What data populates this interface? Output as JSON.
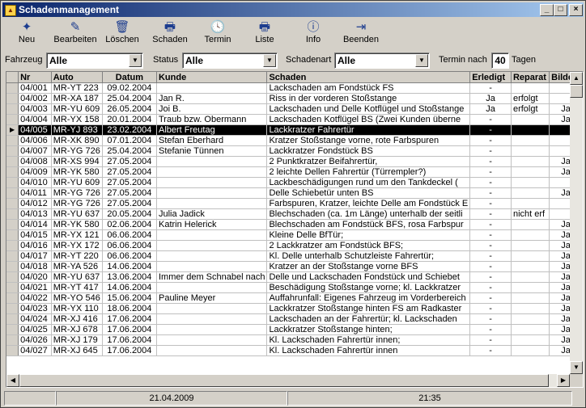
{
  "window": {
    "title": "Schadenmanagement",
    "min": "_",
    "max": "□",
    "close": "×"
  },
  "toolbar": [
    {
      "key": "neu",
      "label": "Neu",
      "icon": "new-doc-icon",
      "glyph": "✦"
    },
    {
      "key": "bearbeiten",
      "label": "Bearbeiten",
      "icon": "pencil-icon",
      "glyph": "✎"
    },
    {
      "key": "loeschen",
      "label": "Löschen",
      "icon": "trash-icon",
      "glyph": "🗑"
    },
    {
      "key": "schaden",
      "label": "Schaden",
      "icon": "printer-icon",
      "glyph": "🖶"
    },
    {
      "key": "termin",
      "label": "Termin",
      "icon": "clock-icon",
      "glyph": "🕓"
    },
    {
      "key": "liste",
      "label": "Liste",
      "icon": "printer-list-icon",
      "glyph": "🖶"
    },
    {
      "key": "info",
      "label": "Info",
      "icon": "info-icon",
      "glyph": "ⓘ"
    },
    {
      "key": "beenden",
      "label": "Beenden",
      "icon": "exit-door-icon",
      "glyph": "⇥"
    }
  ],
  "filters": {
    "fahrzeug_label": "Fahrzeug",
    "fahrzeug_value": "Alle",
    "status_label": "Status",
    "status_value": "Alle",
    "schadenart_label": "Schadenart",
    "schadenart_value": "Alle",
    "termin_label": "Termin nach",
    "termin_value": "40",
    "termin_unit": "Tagen"
  },
  "grid": {
    "columns": [
      "Nr",
      "Auto",
      "Datum",
      "Kunde",
      "Schaden",
      "Erledigt",
      "Reparat",
      "Bilder"
    ],
    "selected_index": 4,
    "rows": [
      [
        "04/001",
        "MR-YT 223",
        "09.02.2004",
        "",
        "Lackschaden am Fondstück FS",
        "-",
        "",
        ""
      ],
      [
        "04/002",
        "MR-XA 187",
        "25.04.2004",
        "Jan R.",
        "Riss in der vorderen Stoßstange",
        "Ja",
        "erfolgt",
        ""
      ],
      [
        "04/003",
        "MR-YU 609",
        "26.05.2004",
        "Joi B.",
        "Lackschaden und Delle Kotflügel und Stoßstange",
        "Ja",
        "erfolgt",
        "Ja"
      ],
      [
        "04/004",
        "MR-YX 158",
        "20.01.2004",
        "Traub bzw. Obermann",
        "Lackschaden Kotflügel BS (Zwei Kunden überne",
        "-",
        "",
        "Ja"
      ],
      [
        "04/005",
        "MR-YJ 893",
        "23.02.2004",
        "Albert Freutag",
        "Lackkratzer Fahrertür",
        "-",
        "",
        ""
      ],
      [
        "04/006",
        "MR-XK 890",
        "07.01.2004",
        "Stefan Eberhard",
        "Kratzer Stoßstange vorne, rote Farbspuren",
        "-",
        "",
        ""
      ],
      [
        "04/007",
        "MR-YG 726",
        "25.04.2004",
        "Stefanie Tünnen",
        "Lackkratzer Fondstück BS",
        "-",
        "",
        ""
      ],
      [
        "04/008",
        "MR-XS 994",
        "27.05.2004",
        "",
        "2 Punktkratzer Beifahrertür,",
        "-",
        "",
        "Ja"
      ],
      [
        "04/009",
        "MR-YK 580",
        "27.05.2004",
        "",
        "2 leichte Dellen Fahrertür (Türrempler?)",
        "-",
        "",
        "Ja"
      ],
      [
        "04/010",
        "MR-YU 609",
        "27.05.2004",
        "",
        "Lackbeschädigungen rund um den Tankdeckel (",
        "-",
        "",
        ""
      ],
      [
        "04/011",
        "MR-YG 726",
        "27.05.2004",
        "",
        "Delle Schiebetür unten BS",
        "-",
        "",
        "Ja"
      ],
      [
        "04/012",
        "MR-YG 726",
        "27.05.2004",
        "",
        "Farbspuren, Kratzer, leichte Delle am Fondstück E",
        "-",
        "",
        ""
      ],
      [
        "04/013",
        "MR-YU 637",
        "20.05.2004",
        "Julia Jadick",
        "Blechschaden (ca. 1m Länge) unterhalb der seitli",
        "-",
        "nicht erf",
        ""
      ],
      [
        "04/014",
        "MR-YK 580",
        "02.06.2004",
        "Katrin Helerick",
        "Blechschaden am Fondstück BFS, rosa Farbspur",
        "-",
        "",
        "Ja"
      ],
      [
        "04/015",
        "MR-YX 121",
        "06.06.2004",
        "",
        "Kleine Delle BfTür;",
        "-",
        "",
        "Ja"
      ],
      [
        "04/016",
        "MR-YX 172",
        "06.06.2004",
        "",
        "2 Lackkratzer am Fondstück BFS;",
        "-",
        "",
        "Ja"
      ],
      [
        "04/017",
        "MR-YT 220",
        "06.06.2004",
        "",
        "Kl. Delle unterhalb Schutzleiste Fahrertür;",
        "-",
        "",
        "Ja"
      ],
      [
        "04/018",
        "MR-YA 526",
        "14.06.2004",
        "",
        "Kratzer an der Stoßstange vorne BFS",
        "-",
        "",
        "Ja"
      ],
      [
        "04/020",
        "MR-YU 637",
        "13.06.2004",
        "Immer dem Schnabel nach",
        "Delle und Lackschaden Fondstück und Schiebet",
        "-",
        "",
        "Ja"
      ],
      [
        "04/021",
        "MR-YT 417",
        "14.06.2004",
        "",
        "Beschädigung Stoßstange vorne; kl. Lackkratzer",
        "-",
        "",
        "Ja"
      ],
      [
        "04/022",
        "MR-YO 546",
        "15.06.2004",
        "Pauline Meyer",
        "Auffahrunfall: Eigenes Fahrzeug im Vorderbereich",
        "-",
        "",
        "Ja"
      ],
      [
        "04/023",
        "MR-YX 110",
        "18.06.2004",
        "",
        "Lackkratzer Stoßstange hinten FS am Radkaster",
        "-",
        "",
        "Ja"
      ],
      [
        "04/024",
        "MR-XJ 416",
        "17.06.2004",
        "",
        "Lackschaden an der Fahrertür; kl. Lackschaden",
        "-",
        "",
        "Ja"
      ],
      [
        "04/025",
        "MR-XJ 678",
        "17.06.2004",
        "",
        "Lackkratzer Stoßstange hinten;",
        "-",
        "",
        "Ja"
      ],
      [
        "04/026",
        "MR-XJ 179",
        "17.06.2004",
        "",
        "Kl. Lackschaden Fahrertür innen;",
        "-",
        "",
        "Ja"
      ],
      [
        "04/027",
        "MR-XJ 645",
        "17.06.2004",
        "",
        "Kl. Lackschaden Fahrertür innen",
        "-",
        "",
        "Ja"
      ]
    ]
  },
  "statusbar": {
    "left": "",
    "date": "21.04.2009",
    "time": "21:35",
    "right": ""
  }
}
